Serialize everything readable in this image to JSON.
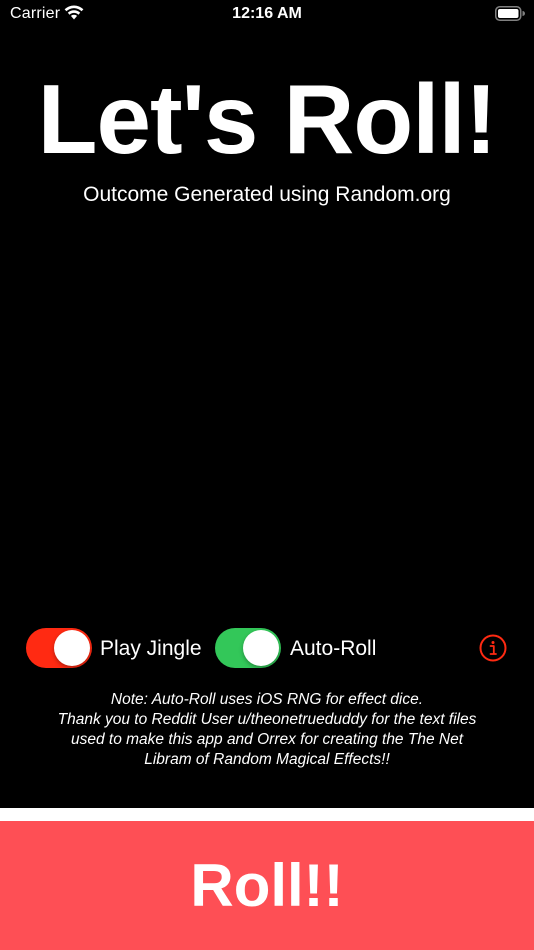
{
  "status_bar": {
    "carrier": "Carrier",
    "time": "12:16 AM",
    "icons": [
      "wifi-icon",
      "battery-icon"
    ]
  },
  "title": "Let's Roll!",
  "subtitle": "Outcome Generated using Random.org",
  "toggles": {
    "play_jingle": {
      "label": "Play Jingle",
      "on": true,
      "color": "#ff2a12"
    },
    "auto_roll": {
      "label": "Auto-Roll",
      "on": true,
      "color": "#33c759"
    }
  },
  "info": {
    "icon": "info-icon",
    "color": "#ff2a12"
  },
  "note": {
    "line1": "Note: Auto-Roll uses iOS RNG for effect dice.",
    "line2": "Thank you to Reddit User u/theonetrueduddy for the text files",
    "line3": "used to make this app and Orrex for creating the The Net",
    "line4": "Libram of Random Magical Effects!!"
  },
  "roll_button": {
    "label": "Roll!!",
    "color": "#fe4f55"
  }
}
